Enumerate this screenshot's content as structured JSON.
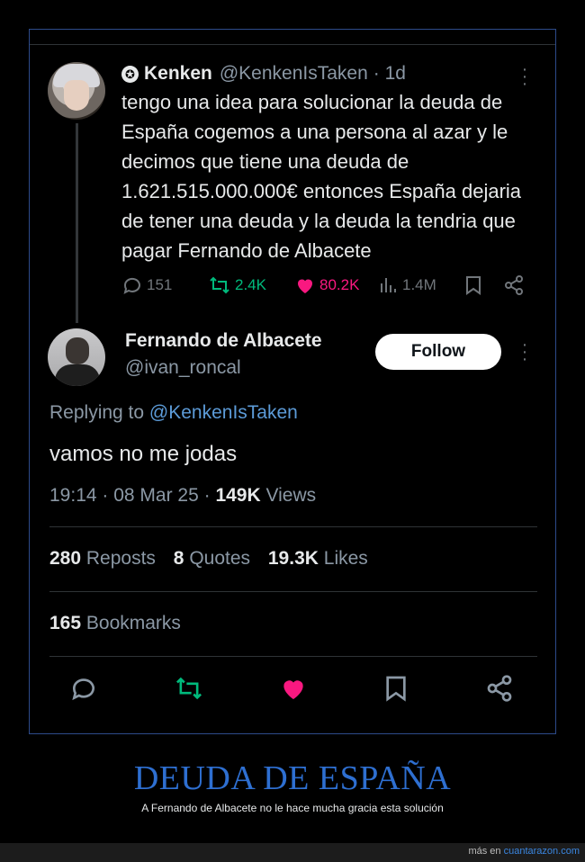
{
  "quoted_tweet": {
    "name": "Kenken",
    "handle": "@KenkenIsTaken",
    "time": "· 1d",
    "text": "tengo una idea para solucionar la deuda de España cogemos a una persona al azar y le decimos que tiene una deuda de 1.621.515.000.000€ entonces España dejaria de tener una deuda y la deuda la tendria que pagar Fernando de Albacete",
    "replies": "151",
    "reposts": "2.4K",
    "likes": "80.2K",
    "views": "1.4M",
    "colors": {
      "repost": "#00ba7c",
      "like": "#f91880",
      "muted": "#71767b"
    }
  },
  "main_tweet": {
    "name": "Fernando de Albacete",
    "handle": "@ivan_roncal",
    "follow_label": "Follow",
    "replying_prefix": "Replying to",
    "replying_to": "@KenkenIsTaken",
    "text": "vamos no me jodas",
    "timestamp": "19:14 · 08 Mar 25 ·",
    "views_count": "149K",
    "views_label": "Views",
    "reposts_count": "280",
    "reposts_label": "Reposts",
    "quotes_count": "8",
    "quotes_label": "Quotes",
    "likes_count": "19.3K",
    "likes_label": "Likes",
    "bookmarks_count": "165",
    "bookmarks_label": "Bookmarks"
  },
  "caption": {
    "title": "DEUDA DE ESPAÑA",
    "subtitle": "A Fernando de Albacete no le hace mucha gracia esta solución"
  },
  "footer": {
    "prefix": "más en",
    "site": "cuantarazon.com"
  }
}
